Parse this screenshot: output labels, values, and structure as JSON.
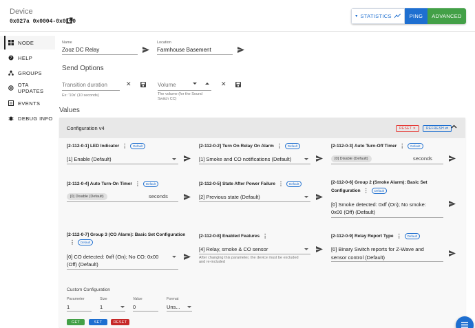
{
  "device": {
    "label": "Device",
    "ids": "0x027a 0x0004-0x0110"
  },
  "toolbar": {
    "statistics": "STATISTICS",
    "ping": "PING",
    "advanced": "ADVANCED"
  },
  "sidebar": {
    "items": [
      {
        "label": "NODE",
        "icon": "grid-icon"
      },
      {
        "label": "HELP",
        "icon": "help-icon"
      },
      {
        "label": "GROUPS",
        "icon": "groups-icon"
      },
      {
        "label": "OTA UPDATES",
        "icon": "ota-icon"
      },
      {
        "label": "EVENTS",
        "icon": "events-icon"
      },
      {
        "label": "DEBUG INFO",
        "icon": "bug-icon"
      }
    ]
  },
  "node": {
    "name_label": "Name",
    "name_value": "Zooz DC Relay",
    "location_label": "Location",
    "location_value": "Farmhouse Basement"
  },
  "send_options": {
    "title": "Send Options",
    "transition_placeholder": "Transition duration",
    "transition_hint": "Ex: '10s' (10 seconds)",
    "volume_placeholder": "Volume",
    "volume_hint": "The volume (for the Sound Switch CC)"
  },
  "values": {
    "title": "Values",
    "panel_title": "Configuration v4",
    "reset": "RESET",
    "refresh": "REFRESH",
    "default_badge": "Default",
    "params": [
      {
        "id": "[2-112-0-1] LED Indicator",
        "value": "[1] Enable (Default)"
      },
      {
        "id": "[2-112-0-2] Turn On Relay On Alarm",
        "value": "[1] Smoke and CO notifications (Default)"
      },
      {
        "id": "[2-112-0-3] Auto Turn-Off Timer",
        "value": "[0] Disable (Default)",
        "unit": "seconds"
      },
      {
        "id": "[2-112-0-4] Auto Turn-On Timer",
        "value": "[0] Disable (Default)",
        "unit": "seconds"
      },
      {
        "id": "[2-112-0-5] State After Power Failure",
        "value": "[2] Previous state (Default)"
      },
      {
        "id": "[2-112-0-6] Group 2 (Smoke Alarm): Basic Set",
        "id2": "Configuration",
        "value": "[0] Smoke detected: 0xff (On); No smoke:",
        "value2": "0x00 (Off) (Default)"
      },
      {
        "id": "[2-112-0-7] Group 3 (CO Alarm): Basic Set Configuration",
        "value": "[0] CO detected: 0xff (On); No CO: 0x00",
        "value2": "(Off) (Default)"
      },
      {
        "id": "[2-112-0-8] Enabled Features",
        "value": "[4] Relay, smoke & CO sensor",
        "hint": "After changing this parameter, the device must be excluded",
        "hint2": "and re-included"
      },
      {
        "id": "[2-112-0-9] Relay Report Type",
        "value": "[0] Binary Switch reports for Z-Wave and",
        "value2": "sensor control (Default)"
      }
    ]
  },
  "custom": {
    "title": "Custom Configuration",
    "parameter_label": "Parameter",
    "parameter_value": "1",
    "size_label": "Size",
    "size_value": "1",
    "value_label": "Value",
    "value_value": "0",
    "format_label": "Format",
    "format_value": "Uns...",
    "get": "GET",
    "set": "SET",
    "reset": "RESET"
  },
  "colors": {
    "primary": "#1e6fd0",
    "success": "#43a047",
    "danger": "#e53935"
  }
}
